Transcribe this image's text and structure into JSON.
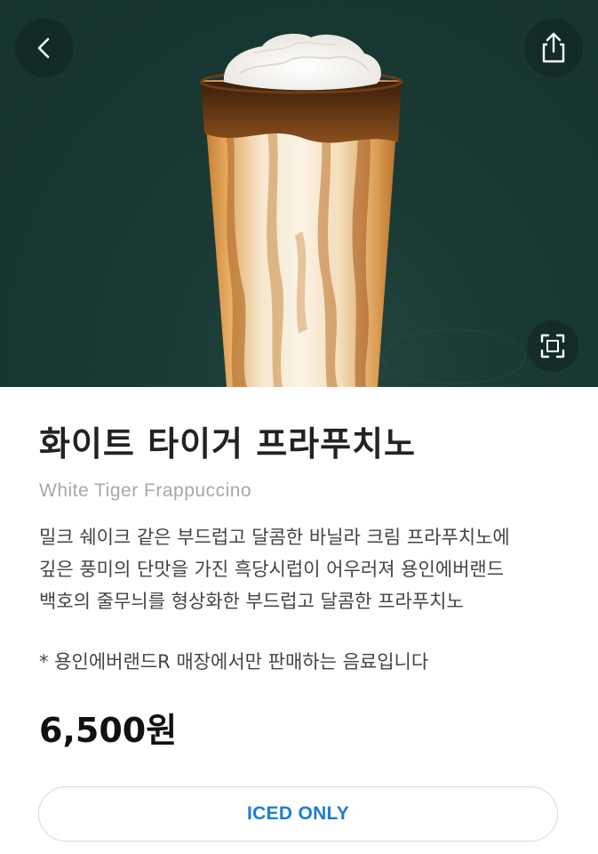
{
  "product": {
    "name_ko": "화이트 타이거 프라푸치노",
    "name_en": "White Tiger Frappuccino",
    "description": "밀크 쉐이크 같은 부드럽고 달콤한 바닐라 크림 프라푸치노에\n깊은 풍미의 단맛을 가진 흑당시럽이 어우러져 용인에버랜드\n백호의 줄무늬를 형상화한 부드럽고 달콤한 프라푸치노",
    "note": "* 용인에버랜드R 매장에서만 판매하는 음료입니다",
    "price": "6,500원",
    "temperature_badge": "ICED ONLY"
  },
  "hero": {
    "background_color": "#1b3a35",
    "image": "white-tiger-frappuccino-photo"
  },
  "icons": {
    "back": "chevron-left-icon",
    "share": "share-icon",
    "expand": "expand-icon"
  },
  "colors": {
    "accent": "#1a7ed4",
    "title": "#222222",
    "subtitle": "#a8a8a8"
  }
}
